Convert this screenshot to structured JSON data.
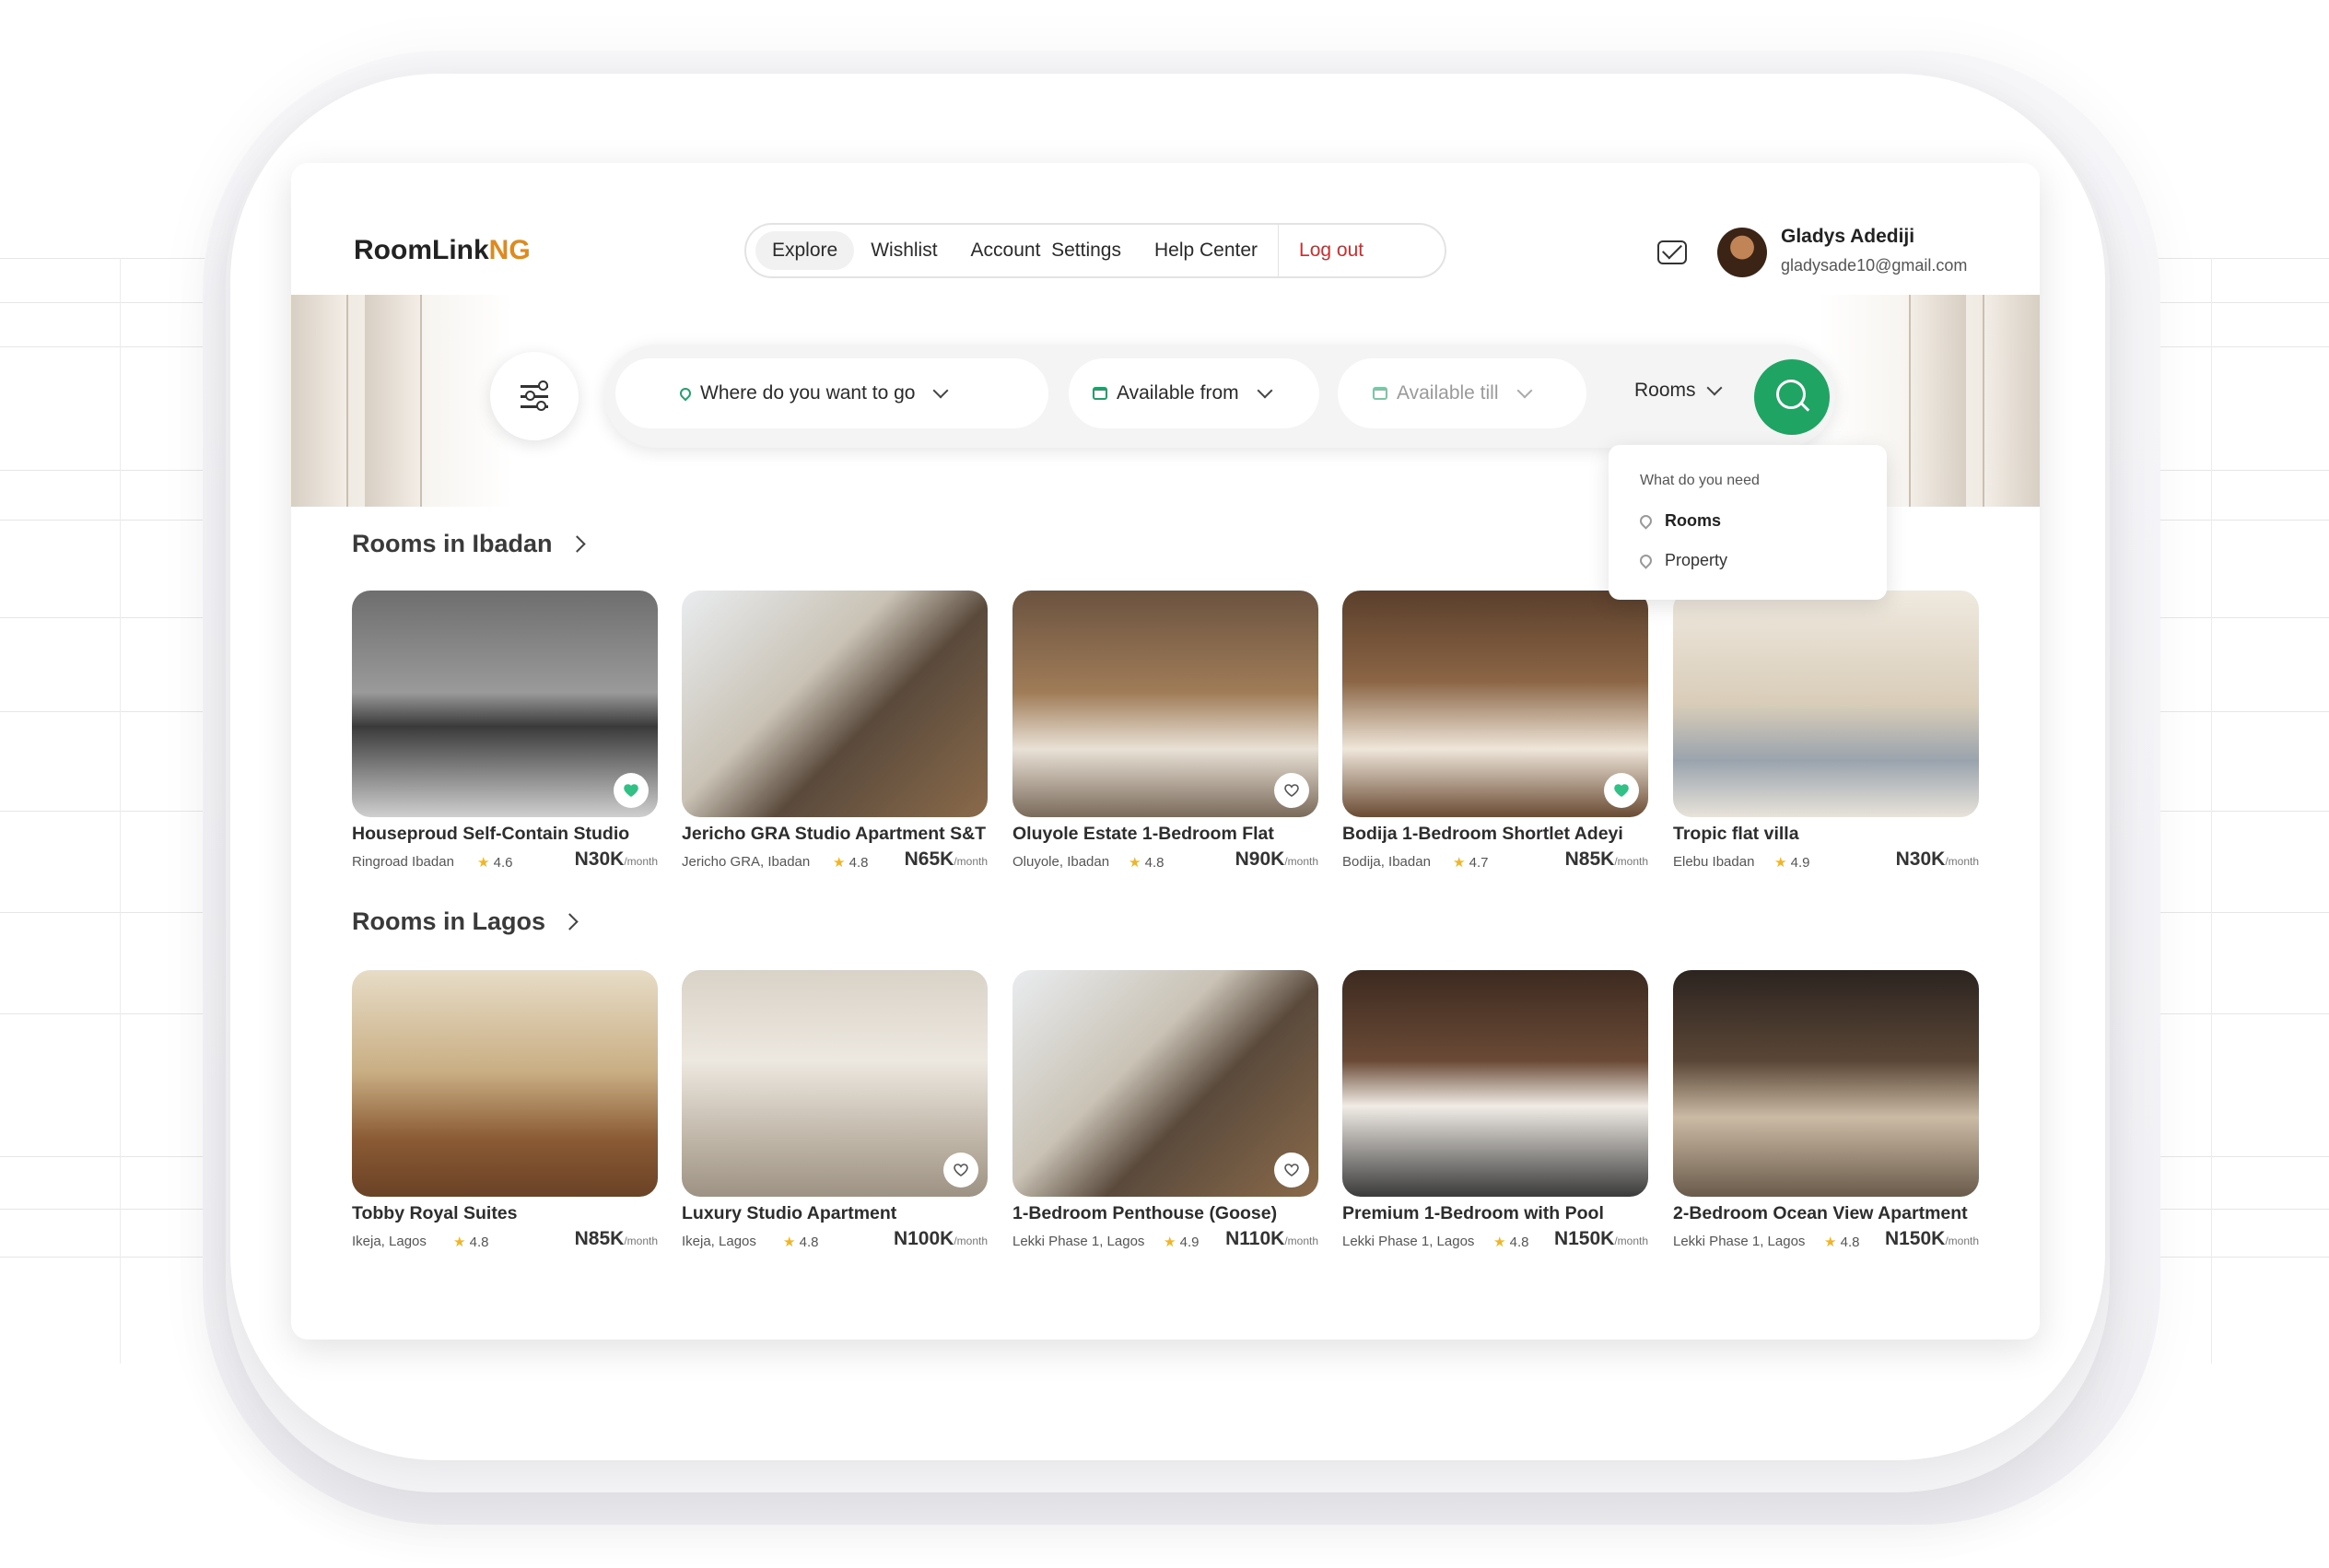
{
  "brand": {
    "name_main": "RoomLink",
    "name_accent": "NG",
    "accent_color": "#e08a1e"
  },
  "nav": {
    "items": [
      "Explore",
      "Wishlist",
      "Account  Settings",
      "Help Center"
    ],
    "logout": "Log out"
  },
  "user": {
    "name": "Gladys Adediji",
    "email": "gladysade10@gmail.com",
    "mail_icon": "envelope-icon"
  },
  "search": {
    "location": "Where do you want to go",
    "from": "Available from",
    "till": "Available till",
    "type": "Rooms",
    "button_color": "#1fa463"
  },
  "dropdown": {
    "title": "What do you need",
    "options": [
      "Rooms",
      "Property"
    ],
    "selected": "Rooms"
  },
  "sections": [
    {
      "title": "Rooms in Ibadan",
      "cards": [
        {
          "name": "Houseproud Self-Contain Studio",
          "location": "Ringroad Ibadan",
          "rating": "4.6",
          "price": "N30K",
          "unit": "/month",
          "favorite": true
        },
        {
          "name": "Jericho GRA Studio Apartment S&T",
          "location": "Jericho GRA, Ibadan",
          "rating": "4.8",
          "price": "N65K",
          "unit": "/month",
          "favorite": null
        },
        {
          "name": "Oluyole Estate 1-Bedroom Flat",
          "location": "Oluyole, Ibadan",
          "rating": "4.8",
          "price": "N90K",
          "unit": "/month",
          "favorite": false
        },
        {
          "name": "Bodija 1-Bedroom Shortlet Adeyi",
          "location": "Bodija, Ibadan",
          "rating": "4.7",
          "price": "N85K",
          "unit": "/month",
          "favorite": true
        },
        {
          "name": "Tropic flat villa",
          "location": "Elebu Ibadan",
          "rating": "4.9",
          "price": "N30K",
          "unit": "/month",
          "favorite": null
        }
      ]
    },
    {
      "title": "Rooms in Lagos",
      "cards": [
        {
          "name": "Tobby Royal Suites",
          "location": "Ikeja, Lagos",
          "rating": "4.8",
          "price": "N85K",
          "unit": "/month",
          "favorite": null
        },
        {
          "name": "Luxury Studio Apartment",
          "location": "Ikeja, Lagos",
          "rating": "4.8",
          "price": "N100K",
          "unit": "/month",
          "favorite": false
        },
        {
          "name": "1-Bedroom Penthouse (Goose)",
          "location": "Lekki Phase 1, Lagos",
          "rating": "4.9",
          "price": "N110K",
          "unit": "/month",
          "favorite": false
        },
        {
          "name": "Premium 1-Bedroom with Pool",
          "location": "Lekki Phase 1, Lagos",
          "rating": "4.8",
          "price": "N150K",
          "unit": "/month",
          "favorite": null
        },
        {
          "name": "2-Bedroom Ocean View Apartment",
          "location": "Lekki Phase 1, Lagos",
          "rating": "4.8",
          "price": "N150K",
          "unit": "/month",
          "favorite": null
        }
      ]
    }
  ]
}
